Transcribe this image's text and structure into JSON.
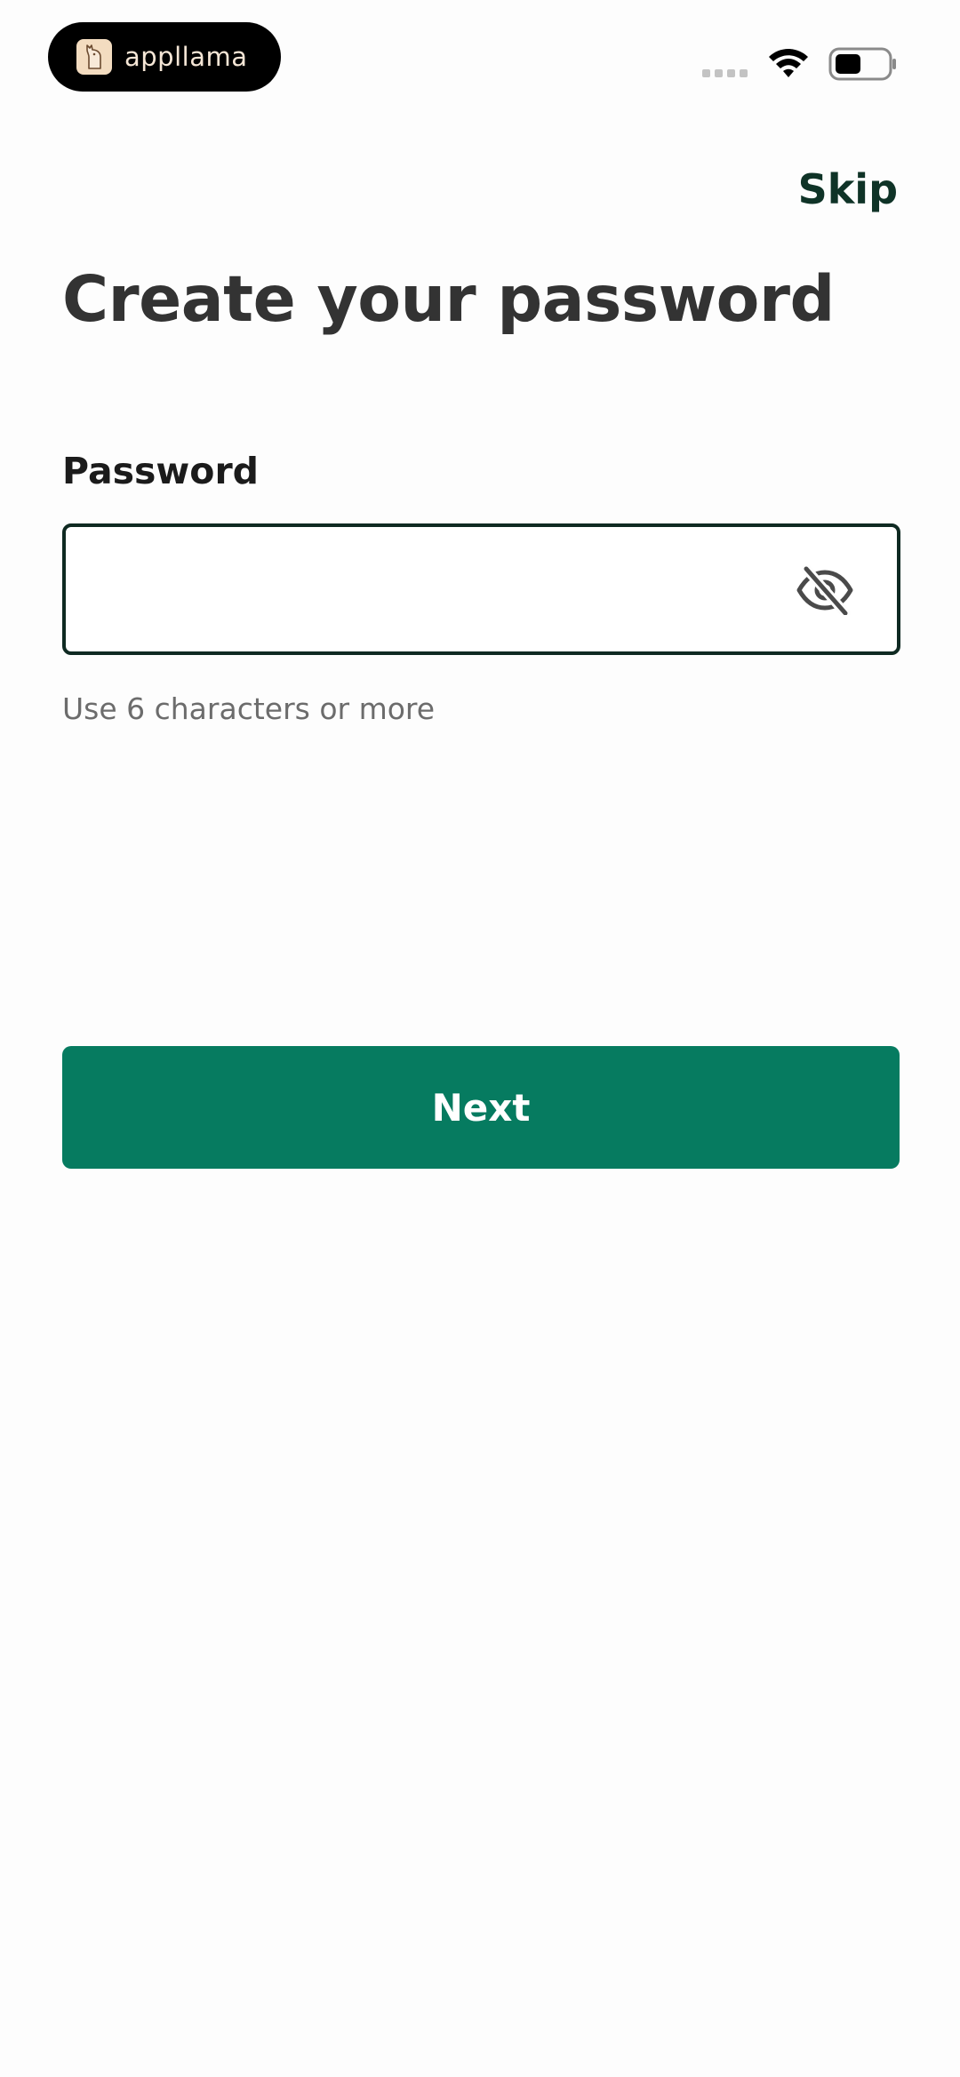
{
  "status_bar": {
    "app_pill_text": "appllama",
    "logo_icon": "llama-logo-icon",
    "signal_icon": "cellular-signal-icon",
    "wifi_icon": "wifi-icon",
    "battery_icon": "battery-icon"
  },
  "header": {
    "skip_label": "Skip"
  },
  "main": {
    "title": "Create your password",
    "password_label": "Password",
    "password_value": "",
    "password_toggle_icon": "eye-slash-icon",
    "hint": "Use 6 characters or more",
    "next_label": "Next"
  },
  "colors": {
    "primary_button": "#067b60",
    "input_border": "#0f2a22",
    "skip_text": "#0f3327",
    "title_text": "#333333",
    "hint_text": "#6c6c6c"
  }
}
